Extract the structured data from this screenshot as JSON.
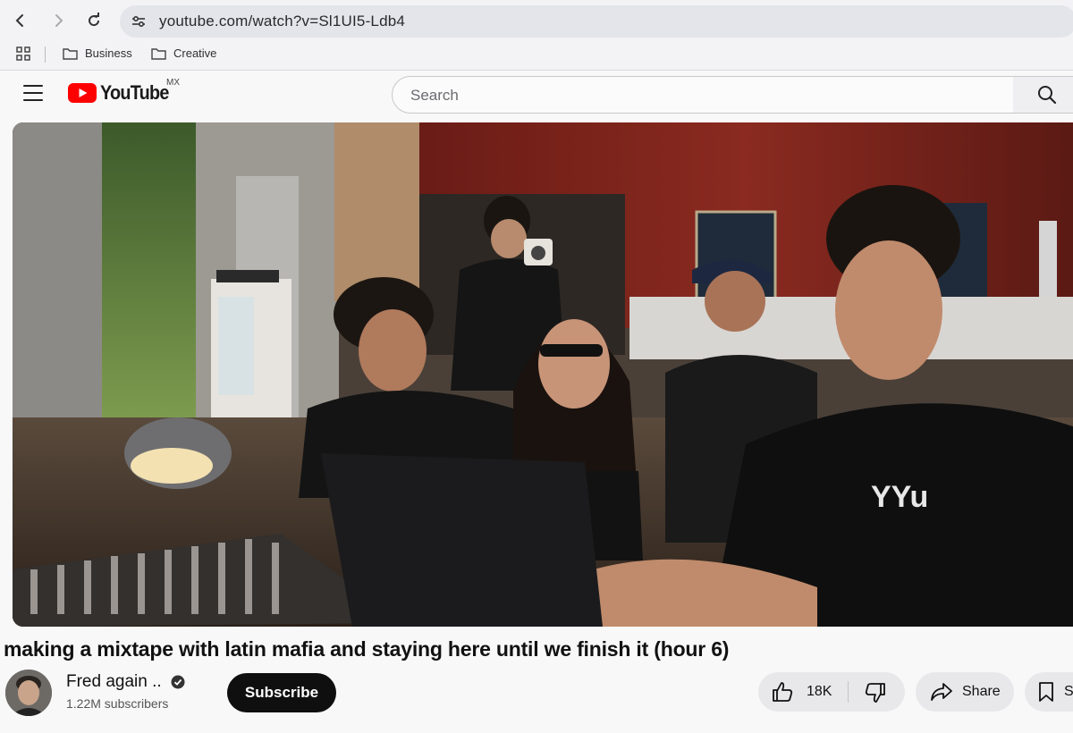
{
  "browser": {
    "url": "youtube.com/watch?v=Sl1UI5-Ldb4",
    "bookmarks": [
      {
        "label": "Business",
        "icon": "folder-icon"
      },
      {
        "label": "Creative",
        "icon": "folder-icon"
      }
    ],
    "icons": [
      "back-arrow-icon",
      "forward-arrow-icon",
      "reload-icon",
      "site-settings-icon",
      "apps-grid-icon"
    ]
  },
  "youtube": {
    "logo_text": "YouTube",
    "region": "MX",
    "search_placeholder": "Search",
    "brand_red": "#ff0000"
  },
  "video": {
    "title": "making a mixtape with latin mafia and staying here until we finish it (hour 6)",
    "thumbnail_description_icon": "video-frame"
  },
  "channel": {
    "name": "Fred again ..",
    "verified": true,
    "subscribers": "1.22M subscribers",
    "subscribe_label": "Subscribe"
  },
  "actions": {
    "like_count": "18K",
    "share_label": "Share",
    "save_label": "S"
  }
}
